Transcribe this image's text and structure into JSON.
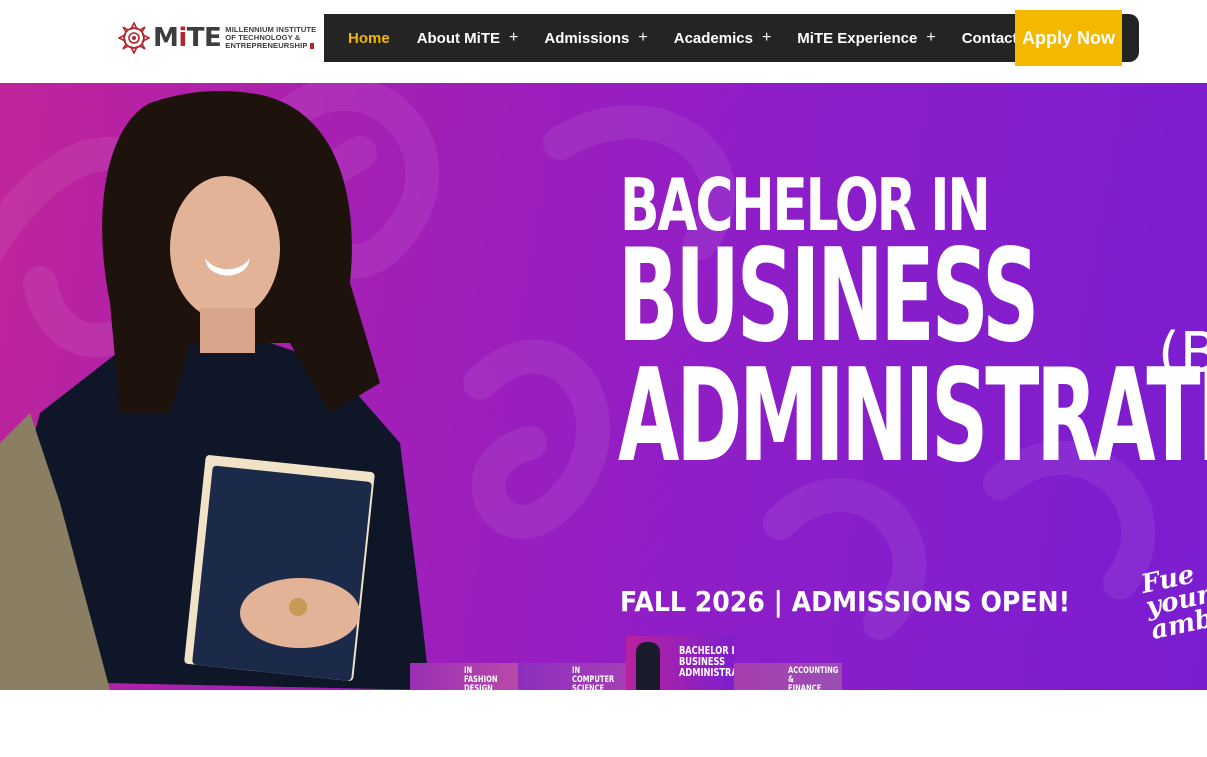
{
  "header": {
    "logo": {
      "word_prefix": "M",
      "word_i": "i",
      "word_suffix": "TE",
      "subtitle_lines": [
        "MILLENNIUM INSTITUTE",
        "OF TECHNOLOGY &",
        "ENTREPRENEURSHIP"
      ],
      "icon": "mandala-logo-icon"
    },
    "nav": [
      {
        "label": "Home",
        "active": true,
        "has_submenu": false
      },
      {
        "label": "About MiTE",
        "active": false,
        "has_submenu": true
      },
      {
        "label": "Admissions",
        "active": false,
        "has_submenu": true
      },
      {
        "label": "Academics",
        "active": false,
        "has_submenu": true
      },
      {
        "label": "MiTE Experience",
        "active": false,
        "has_submenu": true
      },
      {
        "label": "Contact Us",
        "active": false,
        "has_submenu": false
      }
    ],
    "submenu_glyph": "+",
    "apply_label": "Apply Now"
  },
  "hero": {
    "line1": "BACHELOR IN",
    "line2": "BUSINESS",
    "line3": "ADMINISTRATIO",
    "paren": "(B",
    "footer": "FALL 2026 | ADMISSIONS OPEN!",
    "tagline": "Fue\nyour\namb",
    "image": "student-holding-books-photo"
  },
  "thumbnails": [
    {
      "label": "IN FASHION\nDESIGN",
      "active": false
    },
    {
      "label": "IN COMPUTER\nSCIENCE",
      "active": false
    },
    {
      "label": "BACHELOR IN\nBUSINESS\nADMINISTRATIO",
      "active": true
    },
    {
      "label": "ACCOUNTING &\nFINANCE",
      "active": false
    }
  ],
  "colors": {
    "nav_bg": "#242424",
    "active": "#f2b705",
    "apply_bg": "#f5b800",
    "brand_red": "#b3262d",
    "hero_start": "#c0249a",
    "hero_end": "#7a1dd0"
  }
}
